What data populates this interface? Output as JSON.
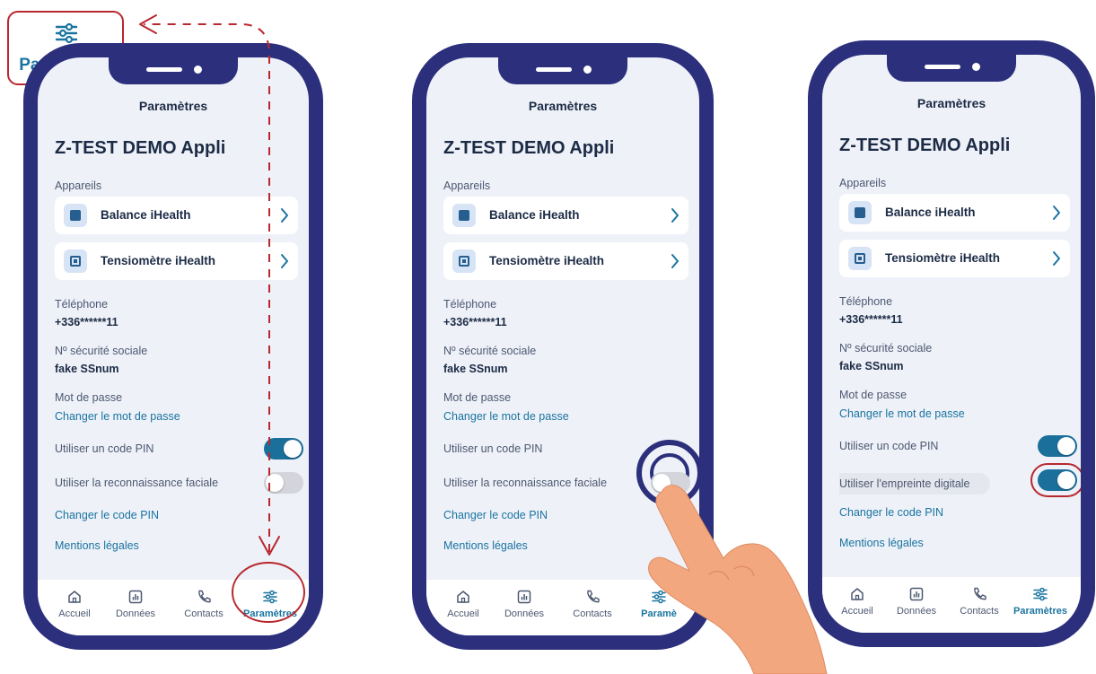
{
  "callout": {
    "label": "Paramètres",
    "icon": "sliders-icon"
  },
  "colors": {
    "phone_frame": "#2b2f7c",
    "accent": "#1a74a0",
    "highlight": "#b8282e",
    "toggle_on": "#1b6f9b",
    "toggle_off": "#d3d5da"
  },
  "screens": [
    {
      "header": "Paramètres",
      "app_title": "Z-TEST DEMO Appli",
      "devices_label": "Appareils",
      "devices": [
        {
          "name": "Balance iHealth",
          "icon": "scale-icon"
        },
        {
          "name": "Tensiomètre iHealth",
          "icon": "blood-pressure-monitor-icon"
        }
      ],
      "phone_label": "Téléphone",
      "phone_value": "+336******11",
      "ssn_label": "Nº sécurité sociale",
      "ssn_value": "fake SSnum",
      "password_label": "Mot de passe",
      "password_link": "Changer le mot de passe",
      "pin_label": "Utiliser un code PIN",
      "pin_enabled": true,
      "bio_label": "Utiliser la reconnaissance faciale",
      "bio_enabled": false,
      "change_pin_link": "Changer le code PIN",
      "legal_link": "Mentions légales",
      "tabs": [
        {
          "label": "Accueil",
          "icon": "home-icon"
        },
        {
          "label": "Données",
          "icon": "chart-icon"
        },
        {
          "label": "Contacts",
          "icon": "phone-icon"
        },
        {
          "label": "Paramètres",
          "icon": "sliders-icon",
          "active": true
        }
      ]
    },
    {
      "header": "Paramètres",
      "app_title": "Z-TEST DEMO Appli",
      "devices_label": "Appareils",
      "devices": [
        {
          "name": "Balance iHealth",
          "icon": "scale-icon"
        },
        {
          "name": "Tensiomètre iHealth",
          "icon": "blood-pressure-monitor-icon"
        }
      ],
      "phone_label": "Téléphone",
      "phone_value": "+336******11",
      "ssn_label": "Nº sécurité sociale",
      "ssn_value": "fake SSnum",
      "password_label": "Mot de passe",
      "password_link": "Changer le mot de passe",
      "pin_label": "Utiliser un code PIN",
      "pin_enabled": false,
      "bio_label": "Utiliser la reconnaissance faciale",
      "bio_enabled": false,
      "change_pin_link": "Changer le code PIN",
      "legal_link": "Mentions légales",
      "tabs": [
        {
          "label": "Accueil",
          "icon": "home-icon"
        },
        {
          "label": "Données",
          "icon": "chart-icon"
        },
        {
          "label": "Contacts",
          "icon": "phone-icon"
        },
        {
          "label": "Paramè",
          "icon": "sliders-icon",
          "active": true
        }
      ]
    },
    {
      "header": "Paramètres",
      "app_title": "Z-TEST DEMO Appli",
      "devices_label": "Appareils",
      "devices": [
        {
          "name": "Balance iHealth",
          "icon": "scale-icon"
        },
        {
          "name": "Tensiomètre iHealth",
          "icon": "blood-pressure-monitor-icon"
        }
      ],
      "phone_label": "Téléphone",
      "phone_value": "+336******11",
      "ssn_label": "Nº sécurité sociale",
      "ssn_value": "fake SSnum",
      "password_label": "Mot de passe",
      "password_link": "Changer le mot de passe",
      "pin_label": "Utiliser un code PIN",
      "pin_enabled": true,
      "bio_label": "Utiliser l'empreinte digitale",
      "bio_enabled": true,
      "change_pin_link": "Changer le code PIN",
      "legal_link": "Mentions légales",
      "tabs": [
        {
          "label": "Accueil",
          "icon": "home-icon"
        },
        {
          "label": "Données",
          "icon": "chart-icon"
        },
        {
          "label": "Contacts",
          "icon": "phone-icon"
        },
        {
          "label": "Paramètres",
          "icon": "sliders-icon",
          "active": true
        }
      ]
    }
  ]
}
